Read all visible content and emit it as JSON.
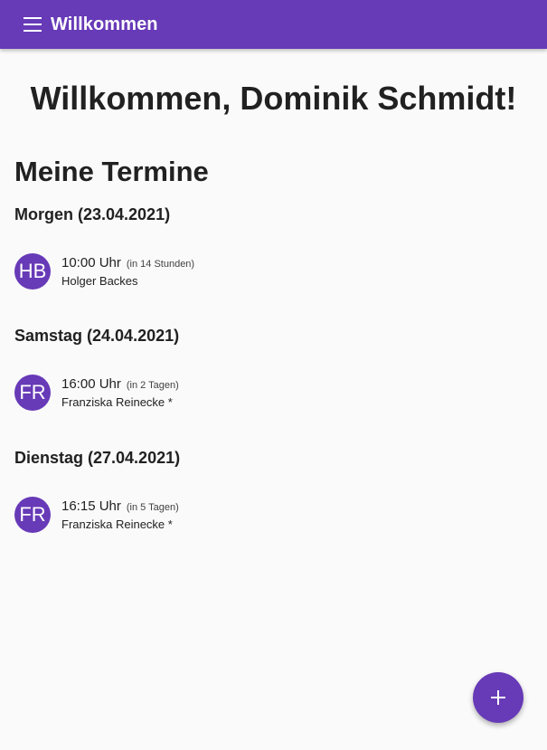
{
  "app_bar": {
    "title": "Willkommen",
    "menu_icon": "menu-icon",
    "color": "#673ab7"
  },
  "welcome_heading": "Willkommen, Dominik Schmidt!",
  "section_title": "Meine Termine",
  "days": [
    {
      "heading": "Morgen (23.04.2021)",
      "appointments": [
        {
          "initials": "HB",
          "time": "10:00 Uhr",
          "relative": "(in 14 Stunden)",
          "person": "Holger Backes"
        }
      ]
    },
    {
      "heading": "Samstag (24.04.2021)",
      "appointments": [
        {
          "initials": "FR",
          "time": "16:00 Uhr",
          "relative": "(in 2 Tagen)",
          "person": "Franziska Reinecke *"
        }
      ]
    },
    {
      "heading": "Dienstag (27.04.2021)",
      "appointments": [
        {
          "initials": "FR",
          "time": "16:15 Uhr",
          "relative": "(in 5 Tagen)",
          "person": "Franziska Reinecke *"
        }
      ]
    }
  ],
  "fab": {
    "icon": "plus-icon"
  }
}
